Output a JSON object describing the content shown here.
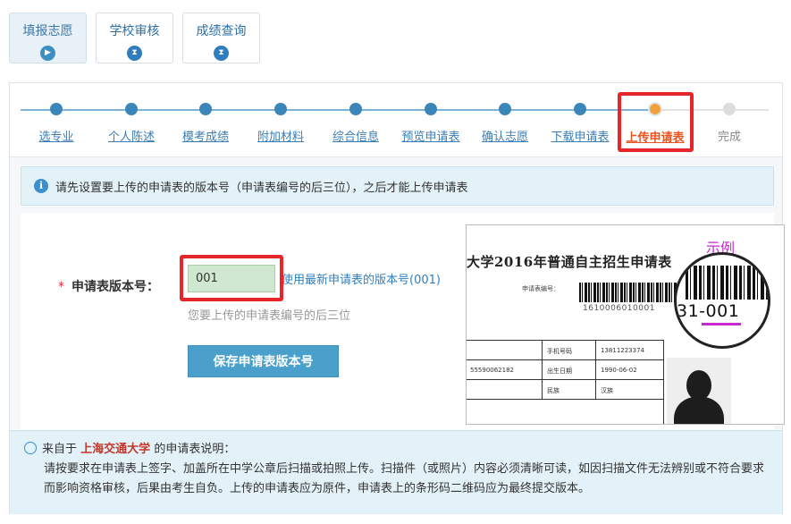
{
  "top_tabs": [
    {
      "label": "填报志愿",
      "icon": "play-circle-icon",
      "active": true
    },
    {
      "label": "学校审核",
      "icon": "hourglass-icon",
      "active": false
    },
    {
      "label": "成绩查询",
      "icon": "hourglass-icon",
      "active": false
    }
  ],
  "steps": [
    {
      "label": "选专业",
      "state": "done"
    },
    {
      "label": "个人陈述",
      "state": "done"
    },
    {
      "label": "模考成绩",
      "state": "done"
    },
    {
      "label": "附加材料",
      "state": "done"
    },
    {
      "label": "综合信息",
      "state": "done"
    },
    {
      "label": "预览申请表",
      "state": "done"
    },
    {
      "label": "确认志愿",
      "state": "done"
    },
    {
      "label": "下载申请表",
      "state": "done"
    },
    {
      "label": "上传申请表",
      "state": "current"
    },
    {
      "label": "完成",
      "state": "todo"
    }
  ],
  "info_bar": {
    "icon": "info-icon",
    "text": "请先设置要上传的申请表的版本号（申请表编号的后三位），之后才能上传申请表"
  },
  "form": {
    "required_mark": "*",
    "label": "申请表版本号：",
    "input_value": "001",
    "use_latest_link": "使用最新申请表的版本号(001)",
    "hint": "您要上传的申请表编号的后三位",
    "save_button": "保存申请表版本号"
  },
  "example_image": {
    "sample_label": "示例",
    "form_title": "大学2016年普通自主招生申请表",
    "form_no_label": "申请表编号：",
    "barcode_number": "1610006010001",
    "magnified_number": "31-001",
    "table_cells": [
      "手机号码",
      "13811223374",
      "55590062182",
      "出生日期",
      "1990-06-02",
      "民族",
      "汉族"
    ]
  },
  "note": {
    "icon": "lightbulb-icon",
    "prefix": "来自于",
    "university": "上海交通大学",
    "suffix": "的申请表说明：",
    "body": "请按要求在申请表上签字、加盖所在中学公章后扫描或拍照上传。扫描件（或照片）内容必须清晰可读，如因扫描文件无法辨别或不符合要求而影响资格审核，后果由考生自负。上传的申请表应为原件，申请表上的条形码二维码应为最终提交版本。"
  },
  "colors": {
    "accent": "#3a86b9",
    "current_step": "#e8541f",
    "highlight_box": "#e8262a",
    "button": "#4a9fcb",
    "info_bg": "#e3f1f8"
  }
}
